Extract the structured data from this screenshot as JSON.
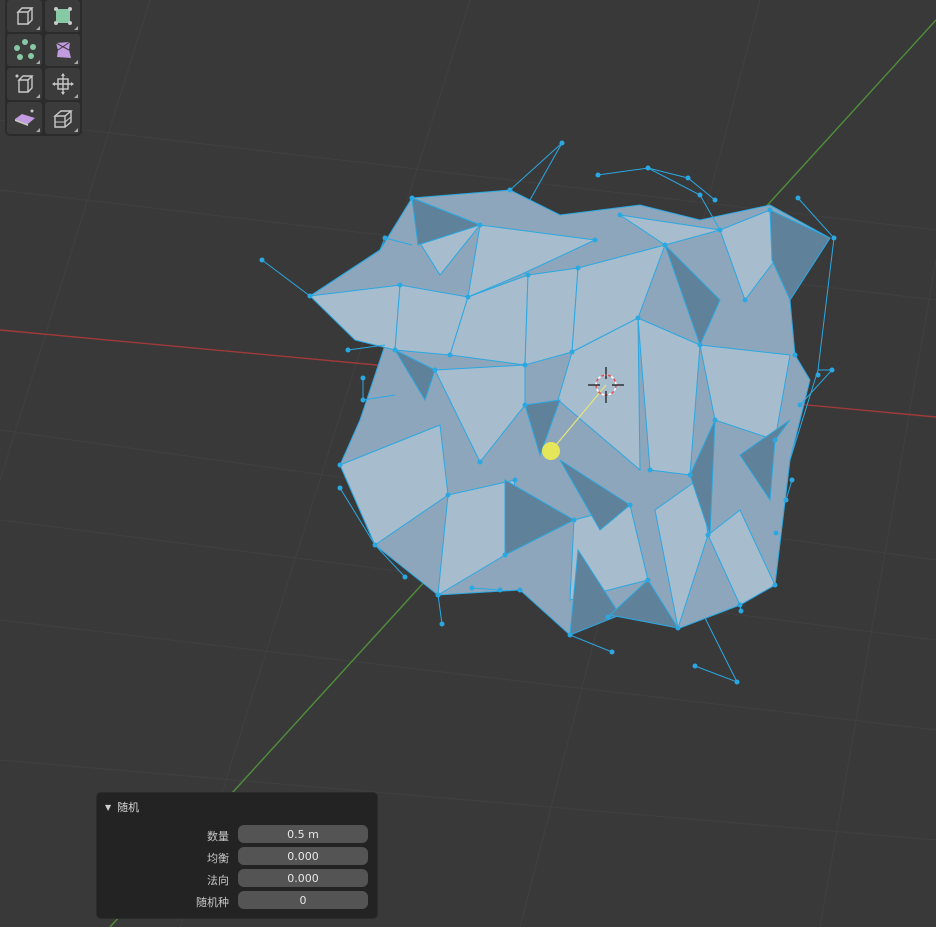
{
  "toolbar": {
    "tools": [
      {
        "name": "extrude-icon"
      },
      {
        "name": "inset-faces-icon"
      },
      {
        "name": "loop-cut-icon"
      },
      {
        "name": "knife-icon"
      },
      {
        "name": "poly-build-icon"
      },
      {
        "name": "spin-icon"
      },
      {
        "name": "smooth-icon"
      },
      {
        "name": "edge-slide-icon"
      }
    ],
    "colors": {
      "green": "#86c9a4",
      "purple": "#c39be0",
      "gray": "#c9c9c9"
    }
  },
  "viewport": {
    "background": "#393939",
    "x_axis_color": "#a03a3a",
    "y_axis_color": "#4f8f3a",
    "mesh_face_color": "#8fa8be",
    "mesh_edge_color": "#2aa8e2",
    "cursor_label": "3d-cursor"
  },
  "operator_panel": {
    "title": "随机",
    "fields": [
      {
        "label": "数量",
        "value": "0.5 m"
      },
      {
        "label": "均衡",
        "value": "0.000"
      },
      {
        "label": "法向",
        "value": "0.000"
      },
      {
        "label": "随机种",
        "value": "0"
      }
    ]
  }
}
